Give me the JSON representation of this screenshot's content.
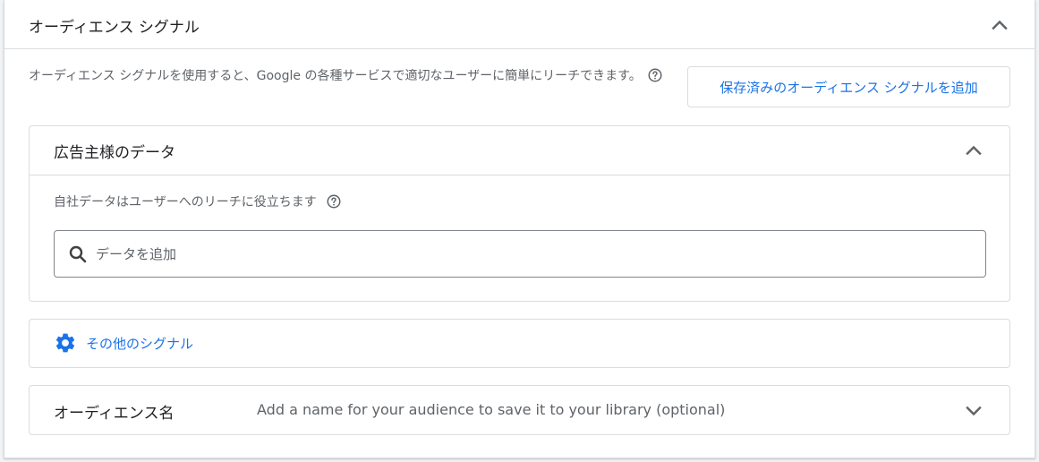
{
  "panel": {
    "title": "オーディエンス シグナル",
    "description": "オーディエンス シグナルを使用すると、Google の各種サービスで適切なユーザーに簡単にリーチできます。",
    "add_saved_button": "保存済みのオーディエンス シグナルを追加"
  },
  "advertiser_data": {
    "title": "広告主様のデータ",
    "subtitle": "自社データはユーザーへのリーチに役立ちます",
    "search_placeholder": "データを追加",
    "search_value": ""
  },
  "other_signals": {
    "label": "その他のシグナル"
  },
  "audience_name": {
    "label": "オーディエンス名",
    "hint": "Add a name for your audience to save it to your library (optional)"
  },
  "colors": {
    "accent": "#1a73e8",
    "text_primary": "#202124",
    "text_secondary": "#5f6368",
    "border": "#dadce0"
  },
  "icons": {
    "collapse": "chevron-up-icon",
    "expand": "chevron-down-icon",
    "help": "help-circle-icon",
    "search": "search-icon",
    "settings": "gear-icon"
  }
}
